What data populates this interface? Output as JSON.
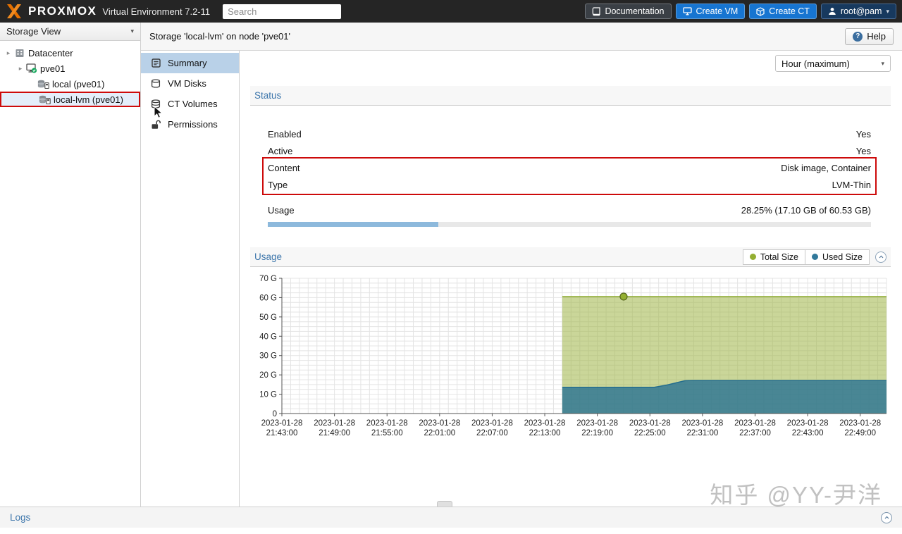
{
  "header": {
    "brand": "PROXMOX",
    "environment": "Virtual Environment 7.2-11",
    "search": {
      "placeholder": "Search"
    },
    "documentation_button": "Documentation",
    "create_vm_button": "Create VM",
    "create_ct_button": "Create CT",
    "user_menu": "root@pam"
  },
  "sidebar": {
    "view_selector": "Storage View",
    "tree": [
      {
        "label": "Datacenter",
        "level": 0,
        "icon": "server-icon",
        "expander": true,
        "selected": false
      },
      {
        "label": "pve01",
        "level": 1,
        "icon": "node-icon",
        "expander": true,
        "selected": false
      },
      {
        "label": "local (pve01)",
        "level": 2,
        "icon": "storage-icon",
        "expander": false,
        "selected": false
      },
      {
        "label": "local-lvm (pve01)",
        "level": 2,
        "icon": "storage-icon",
        "expander": false,
        "selected": true
      }
    ]
  },
  "subnav": {
    "items": [
      {
        "label": "Summary",
        "icon": "summary-icon",
        "selected": true
      },
      {
        "label": "VM Disks",
        "icon": "disks-icon",
        "selected": false
      },
      {
        "label": "CT Volumes",
        "icon": "volumes-icon",
        "selected": false
      },
      {
        "label": "Permissions",
        "icon": "permissions-icon",
        "selected": false
      }
    ]
  },
  "toolbar": {
    "title": "Storage 'local-lvm' on node 'pve01'",
    "help_button": "Help"
  },
  "main": {
    "time_range": "Hour (maximum)",
    "status": {
      "title": "Status",
      "rows": [
        {
          "label": "Enabled",
          "value": "Yes",
          "annotated": false
        },
        {
          "label": "Active",
          "value": "Yes",
          "annotated": false
        },
        {
          "label": "Content",
          "value": "Disk image, Container",
          "annotated": true
        },
        {
          "label": "Type",
          "value": "LVM-Thin",
          "annotated": true
        },
        {
          "label": "Usage",
          "value": "28.25% (17.10 GB of 60.53 GB)",
          "annotated": false,
          "progress_percent": 28.25
        }
      ]
    },
    "usage": {
      "title": "Usage",
      "legend": [
        {
          "label": "Total Size",
          "color": "#94af32"
        },
        {
          "label": "Used Size",
          "color": "#31799b"
        }
      ]
    }
  },
  "logs": {
    "title": "Logs"
  },
  "watermark": "知乎 @YY-尹洋",
  "annotation_color": "#cd0a0a",
  "chart_data": {
    "type": "area",
    "title": "Usage",
    "ylabel": "",
    "xlabel": "",
    "ylim": [
      0,
      70
    ],
    "xlim": [
      0,
      69
    ],
    "grid": true,
    "legend_position": "top-right",
    "x_unit": "minutes since 2023-01-28 21:43:00",
    "y_ticks": [
      {
        "v": 70,
        "label": "70 G"
      },
      {
        "v": 60,
        "label": "60 G"
      },
      {
        "v": 50,
        "label": "50 G"
      },
      {
        "v": 40,
        "label": "40 G"
      },
      {
        "v": 30,
        "label": "30 G"
      },
      {
        "v": 20,
        "label": "20 G"
      },
      {
        "v": 10,
        "label": "10 G"
      },
      {
        "v": 0,
        "label": "0"
      }
    ],
    "x_axis_ticks": [
      {
        "minute": 0,
        "date": "2023-01-28",
        "time": "21:43:00"
      },
      {
        "minute": 6,
        "date": "2023-01-28",
        "time": "21:49:00"
      },
      {
        "minute": 12,
        "date": "2023-01-28",
        "time": "21:55:00"
      },
      {
        "minute": 18,
        "date": "2023-01-28",
        "time": "22:01:00"
      },
      {
        "minute": 24,
        "date": "2023-01-28",
        "time": "22:07:00"
      },
      {
        "minute": 30,
        "date": "2023-01-28",
        "time": "22:13:00"
      },
      {
        "minute": 36,
        "date": "2023-01-28",
        "time": "22:19:00"
      },
      {
        "minute": 42,
        "date": "2023-01-28",
        "time": "22:25:00"
      },
      {
        "minute": 48,
        "date": "2023-01-28",
        "time": "22:31:00"
      },
      {
        "minute": 54,
        "date": "2023-01-28",
        "time": "22:37:00"
      },
      {
        "minute": 60,
        "date": "2023-01-28",
        "time": "22:43:00"
      },
      {
        "minute": 66,
        "date": "2023-01-28",
        "time": "22:49:00"
      }
    ],
    "series": [
      {
        "name": "Total Size",
        "unit": "GB",
        "color": "#8caa2e",
        "fill": "rgba(158,181,69,0.55)",
        "points": [
          [
            32,
            60.53
          ],
          [
            69,
            60.53
          ]
        ]
      },
      {
        "name": "Used Size",
        "unit": "GB",
        "color": "#246d8e",
        "fill": "rgba(44,116,146,0.82)",
        "points": [
          [
            32,
            13.6
          ],
          [
            42.5,
            13.6
          ],
          [
            44,
            14.8
          ],
          [
            46,
            17.0
          ],
          [
            47,
            17.1
          ],
          [
            69,
            17.1
          ]
        ]
      }
    ],
    "marker": {
      "series": "Total Size",
      "x": 39,
      "y": 60.53,
      "fill": "#94af32",
      "stroke": "#55661e"
    }
  }
}
